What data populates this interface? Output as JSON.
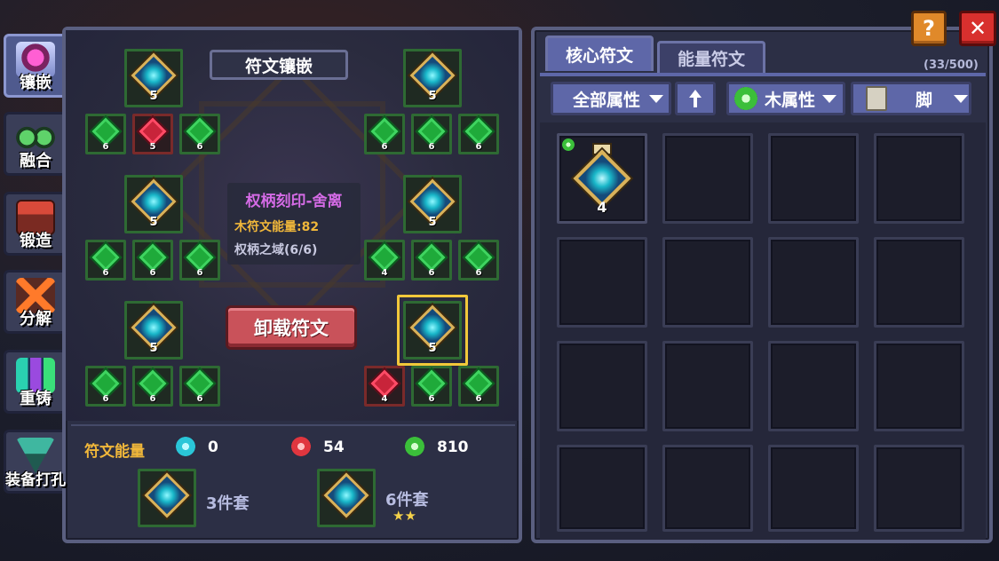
{
  "side_tabs": [
    {
      "label": "镶嵌",
      "icon": "rune-inlay-icon",
      "active": true
    },
    {
      "label": "融合",
      "icon": "goggles-icon",
      "active": false
    },
    {
      "label": "锻造",
      "icon": "forge-chest-icon",
      "active": false
    },
    {
      "label": "分解",
      "icon": "disassemble-icon",
      "active": false
    },
    {
      "label": "重铸",
      "icon": "crystals-icon",
      "active": false
    },
    {
      "label": "装备打孔",
      "icon": "drill-icon",
      "active": false
    }
  ],
  "inlay": {
    "title": "符文镶嵌",
    "core_slots": [
      {
        "level": "5"
      },
      {
        "level": "5"
      },
      {
        "level": "5"
      },
      {
        "level": "5"
      },
      {
        "level": "5"
      },
      {
        "level": "5"
      }
    ],
    "small_slots": [
      [
        "6",
        "5",
        "6"
      ],
      [
        "6",
        "6",
        "6"
      ],
      [
        "6",
        "6",
        "6"
      ],
      [
        "4",
        "6",
        "6"
      ],
      [
        "6",
        "6",
        "6"
      ],
      [
        "4",
        "6",
        "6"
      ]
    ],
    "tooltip": {
      "name": "权柄刻印-舍离",
      "energy": "木符文能量:82",
      "set": "权柄之域(6/6)"
    },
    "unload_button": "卸载符文"
  },
  "rune_energy": {
    "label": "符文能量",
    "values": [
      {
        "icon": "cyan-energy-icon",
        "value": "0"
      },
      {
        "icon": "fire-energy-icon",
        "value": "54"
      },
      {
        "icon": "wood-energy-icon",
        "value": "810"
      }
    ]
  },
  "sets": [
    {
      "label": "3件套",
      "stars": ""
    },
    {
      "label": "6件套",
      "stars": "★★"
    }
  ],
  "inventory": {
    "tabs": [
      "核心符文",
      "能量符文"
    ],
    "count": "(33/500)",
    "filters": {
      "all_attr": "全部属性",
      "sort_icon": "up-arrow-icon",
      "wood_attr": "木属性",
      "slot_type": "脚"
    },
    "first_item_level": "4"
  },
  "top_buttons": {
    "help": "?",
    "close": "✕"
  },
  "colors": {
    "accent_green": "#1faa3a",
    "selected_gold": "#f2c83a",
    "unload_red": "#c9525a"
  }
}
